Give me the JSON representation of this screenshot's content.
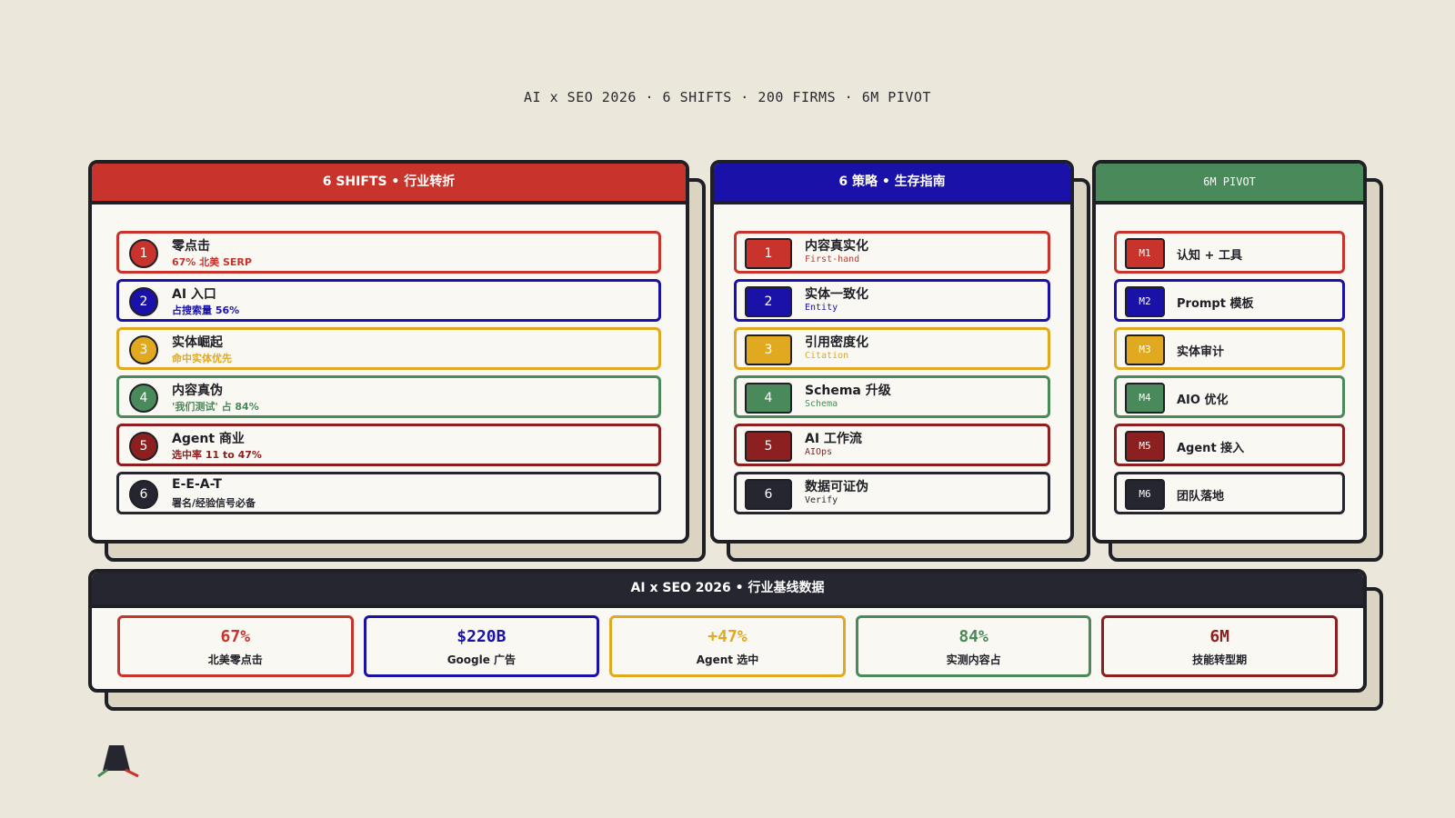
{
  "page_title": "AI x SEO 2026 · 6 SHIFTS · 200 FIRMS · 6M PIVOT",
  "colors": {
    "red": "#c8342c",
    "blue": "#1a12a8",
    "yellow": "#e0a920",
    "green": "#4a8a5a",
    "maroon": "#8c1f1f",
    "dark": "#262630",
    "bg": "#ebe7da",
    "card": "#faf8f3"
  },
  "shifts": {
    "header": "6 SHIFTS • 行业转折",
    "items": [
      {
        "num": "1",
        "title": "零点击",
        "sub": "67% 北美 SERP",
        "color": "#c8342c"
      },
      {
        "num": "2",
        "title": "AI 入口",
        "sub": "占搜索量 56%",
        "color": "#1a12a8"
      },
      {
        "num": "3",
        "title": "实体崛起",
        "sub": "命中实体优先",
        "color": "#e0a920"
      },
      {
        "num": "4",
        "title": "内容真伪",
        "sub": "'我们测试' 占 84%",
        "color": "#4a8a5a"
      },
      {
        "num": "5",
        "title": "Agent 商业",
        "sub": "选中率 11 to 47%",
        "color": "#8c1f1f"
      },
      {
        "num": "6",
        "title": "E-E-A-T",
        "sub": "署名/经验信号必备",
        "color": "#262630"
      }
    ]
  },
  "strategies": {
    "header": "6 策略 • 生存指南",
    "items": [
      {
        "num": "1",
        "title": "内容真实化",
        "sub": "First-hand",
        "color": "#c8342c"
      },
      {
        "num": "2",
        "title": "实体一致化",
        "sub": "Entity",
        "color": "#1a12a8"
      },
      {
        "num": "3",
        "title": "引用密度化",
        "sub": "Citation",
        "color": "#e0a920"
      },
      {
        "num": "4",
        "title": "Schema 升级",
        "sub": "Schema",
        "color": "#4a8a5a"
      },
      {
        "num": "5",
        "title": "AI 工作流",
        "sub": "AIOps",
        "color": "#8c1f1f"
      },
      {
        "num": "6",
        "title": "数据可证伪",
        "sub": "Verify",
        "color": "#262630"
      }
    ]
  },
  "pivot": {
    "header": "6M PIVOT",
    "items": [
      {
        "num": "M1",
        "title": "认知 + 工具",
        "color": "#c8342c"
      },
      {
        "num": "M2",
        "title": "Prompt 模板",
        "color": "#1a12a8"
      },
      {
        "num": "M3",
        "title": "实体审计",
        "color": "#e0a920"
      },
      {
        "num": "M4",
        "title": "AIO 优化",
        "color": "#4a8a5a"
      },
      {
        "num": "M5",
        "title": "Agent 接入",
        "color": "#8c1f1f"
      },
      {
        "num": "M6",
        "title": "团队落地",
        "color": "#262630"
      }
    ]
  },
  "baseline": {
    "header": "AI x SEO 2026 • 行业基线数据",
    "stats": [
      {
        "value": "67%",
        "label": "北美零点击",
        "color": "#c8342c"
      },
      {
        "value": "$220B",
        "label": "Google 广告",
        "color": "#1a12a8"
      },
      {
        "value": "+47%",
        "label": "Agent 选中",
        "color": "#e0a920"
      },
      {
        "value": "84%",
        "label": "实测内容占",
        "color": "#4a8a5a"
      },
      {
        "value": "6M",
        "label": "技能转型期",
        "color": "#8c1f1f"
      }
    ]
  },
  "logo_icon": "triangle-logo-icon"
}
